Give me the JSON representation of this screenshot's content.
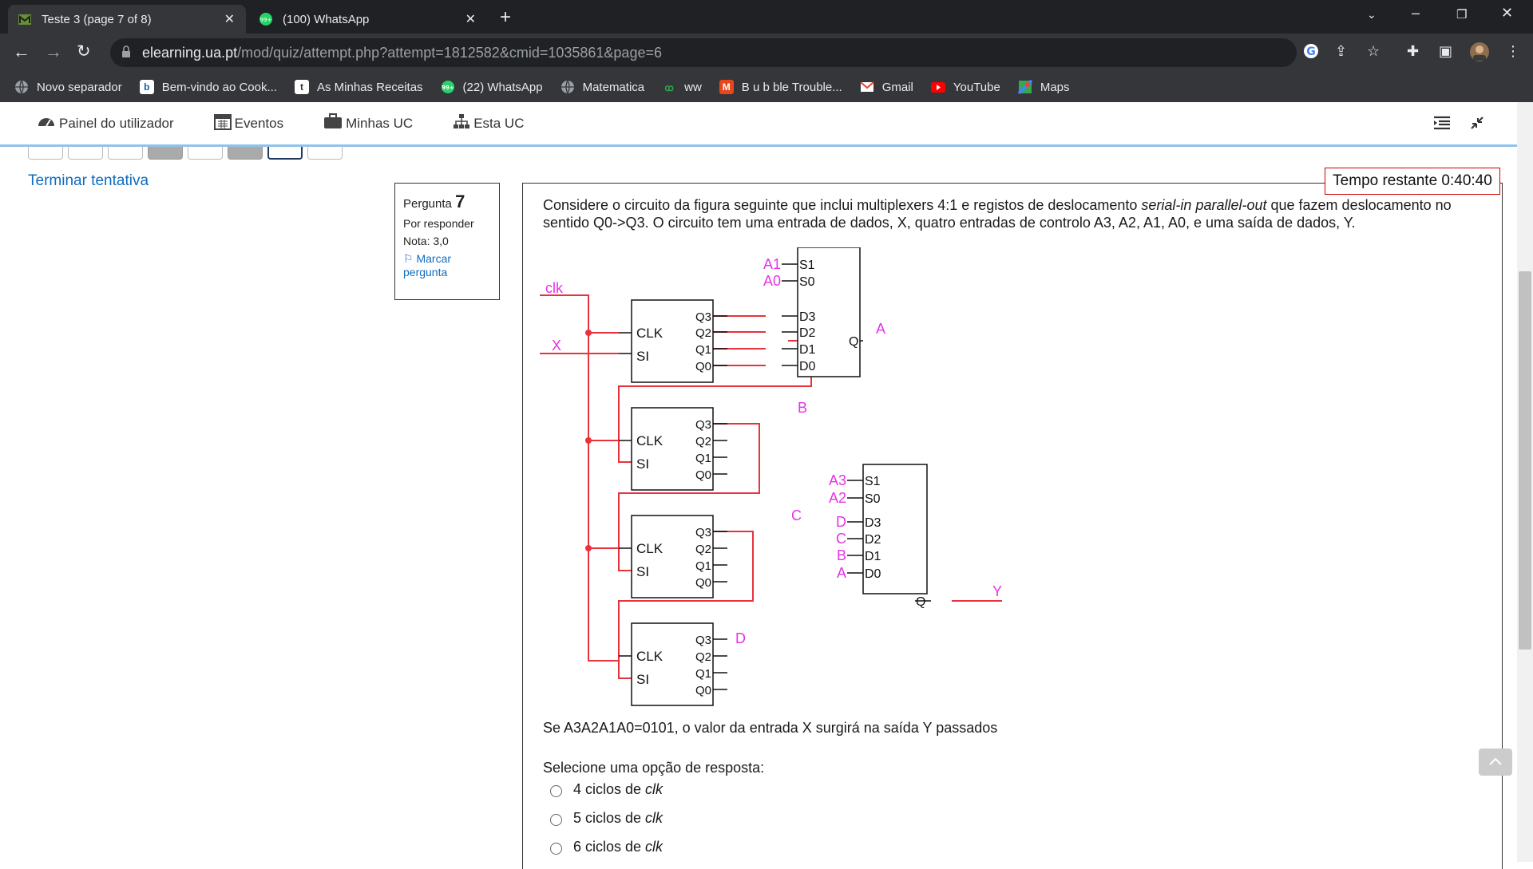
{
  "tabs": [
    {
      "title": "Teste 3 (page 7 of 8)",
      "icon": "moodle-icon"
    },
    {
      "title": "(100) WhatsApp",
      "icon": "whatsapp-icon"
    }
  ],
  "address": {
    "host": "elearning.ua.pt",
    "path": "/mod/quiz/attempt.php?attempt=1812582&cmid=1035861&page=6"
  },
  "bookmarks": [
    {
      "label": "Novo separador",
      "icon": "globe-icon",
      "color": "#9aa0a6"
    },
    {
      "label": "Bem-vindo ao Cook...",
      "icon": "b-icon",
      "color": "#ffffff"
    },
    {
      "label": "As Minhas Receitas",
      "icon": "t-icon",
      "color": "#ffffff"
    },
    {
      "label": "(22) WhatsApp",
      "icon": "whatsapp-icon",
      "color": "#25d366"
    },
    {
      "label": "Matematica",
      "icon": "globe-icon",
      "color": "#9aa0a6"
    },
    {
      "label": "ww",
      "icon": "ww-icon",
      "color": "#2fa84f"
    },
    {
      "label": "B u b   ble Trouble...",
      "icon": "game-icon",
      "color": "#e8471c"
    },
    {
      "label": "Gmail",
      "icon": "gmail-icon",
      "color": "#ea4335"
    },
    {
      "label": "YouTube",
      "icon": "youtube-icon",
      "color": "#ff0000"
    },
    {
      "label": "Maps",
      "icon": "maps-icon",
      "color": "#34a853"
    }
  ],
  "nav": {
    "dashboard": "Painel do utilizador",
    "events": "Eventos",
    "my_courses": "Minhas UC",
    "this_course": "Esta UC"
  },
  "finish_attempt": "Terminar tentativa",
  "question_info": {
    "label": "Pergunta",
    "number": "7",
    "status": "Por responder",
    "grade": "Nota: 3,0",
    "flag": "Marcar pergunta"
  },
  "timer": "Tempo restante 0:40:40",
  "question": {
    "text_a": "Considere o circuito da figura seguinte que inclui multiplexers 4:1 e registos de deslocamento ",
    "text_em": "serial-in parallel-out",
    "text_b": " que fazem deslocamento no sentido Q0->Q3. O circuito tem uma entrada de dados, X, quatro entradas de controlo A3, A2, A1, A0, e uma saída de dados, Y.",
    "sub": "Se A3A2A1A0=0101, o valor da entrada X surgirá na saída Y passados",
    "prompt": "Selecione uma opção de resposta:",
    "options": [
      {
        "text": "4 ciclos de ",
        "em": "clk"
      },
      {
        "text": "5 ciclos de ",
        "em": "clk"
      },
      {
        "text": "6 ciclos de ",
        "em": "clk"
      }
    ]
  },
  "circuit": {
    "clk": "clk",
    "x": "X",
    "reg_clk": "CLK",
    "reg_si": "SI",
    "q": [
      "Q3",
      "Q2",
      "Q1",
      "Q0"
    ],
    "mux_s": [
      "S1",
      "S0"
    ],
    "mux_d": [
      "D3",
      "D2",
      "D1",
      "D0"
    ],
    "mux_q": "Q",
    "mux1_sel": [
      "A1",
      "A0"
    ],
    "mux2_sel": [
      "A3",
      "A2"
    ],
    "mux2_inputs": [
      "D",
      "C",
      "B",
      "A"
    ],
    "outputs": [
      "A",
      "B",
      "C",
      "D"
    ],
    "y": "Y",
    "colors": {
      "wire": "#e8323c",
      "label": "#e632e6",
      "ink": "#111111"
    }
  }
}
